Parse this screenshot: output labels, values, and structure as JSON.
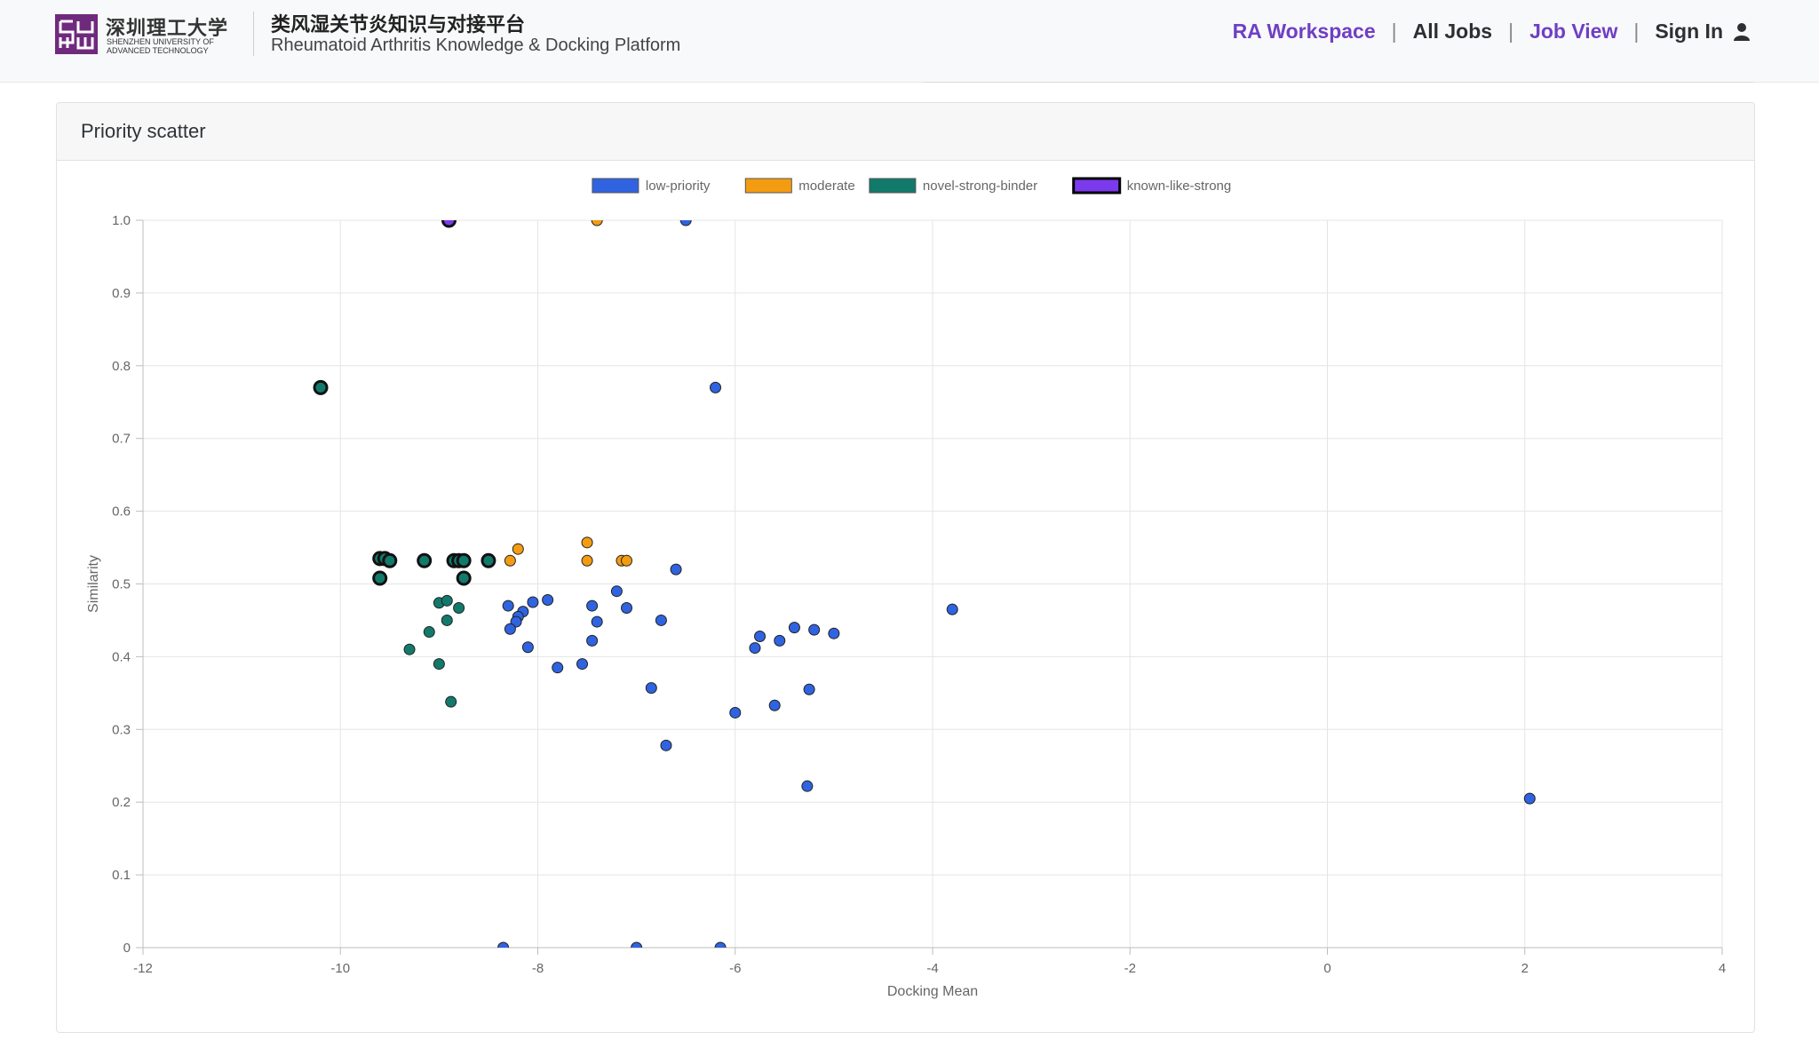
{
  "header": {
    "logo": {
      "cn": "深圳理工大学",
      "en": "SHENZHEN UNIVERSITY OF ADVANCED TECHNOLOGY",
      "mark": "SUAT"
    },
    "title_cn": "类风湿关节炎知识与对接平台",
    "title_en": "Rheumatoid Arthritis Knowledge & Docking Platform"
  },
  "nav": {
    "items": [
      {
        "label": "RA Workspace",
        "color": "#6f3fc4"
      },
      {
        "label": "All Jobs",
        "color": "#2d2f33"
      },
      {
        "label": "Job View",
        "color": "#6f3fc4"
      },
      {
        "label": "Sign In",
        "color": "#2d2f33"
      }
    ],
    "separator": "|",
    "user_icon": "user-icon"
  },
  "panel": {
    "title": "Priority scatter"
  },
  "chart_data": {
    "type": "scatter",
    "xlabel": "Docking Mean",
    "ylabel": "Similarity",
    "xlim": [
      -12,
      4
    ],
    "ylim": [
      0,
      1
    ],
    "x_ticks": [
      -12,
      -10,
      -8,
      -6,
      -4,
      -2,
      0,
      2,
      4
    ],
    "y_ticks": [
      0,
      0.1,
      0.2,
      0.3,
      0.4,
      0.5,
      0.6,
      0.7,
      0.8,
      0.9,
      1.0
    ],
    "y_tick_labels": [
      "0",
      "0.1",
      "0.2",
      "0.3",
      "0.4",
      "0.5",
      "0.6",
      "0.7",
      "0.8",
      "0.9",
      "1.0"
    ],
    "grid": true,
    "legend_position": "top-center",
    "series": [
      {
        "name": "low-priority",
        "color": "#2f63e0",
        "points": [
          [
            -6.2,
            0.77
          ],
          [
            -6.6,
            0.52
          ],
          [
            -3.8,
            0.465
          ],
          [
            2.05,
            0.205
          ],
          [
            -7.2,
            0.49
          ],
          [
            -7.45,
            0.47
          ],
          [
            -7.1,
            0.467
          ],
          [
            -7.9,
            0.478
          ],
          [
            -8.05,
            0.475
          ],
          [
            -8.3,
            0.47
          ],
          [
            -8.15,
            0.462
          ],
          [
            -8.2,
            0.455
          ],
          [
            -8.22,
            0.448
          ],
          [
            -8.28,
            0.438
          ],
          [
            -7.4,
            0.448
          ],
          [
            -7.45,
            0.422
          ],
          [
            -8.1,
            0.413
          ],
          [
            -7.8,
            0.385
          ],
          [
            -7.55,
            0.39
          ],
          [
            -6.75,
            0.45
          ],
          [
            -5.8,
            0.412
          ],
          [
            -5.75,
            0.428
          ],
          [
            -5.55,
            0.422
          ],
          [
            -5.4,
            0.44
          ],
          [
            -5.2,
            0.437
          ],
          [
            -5.0,
            0.432
          ],
          [
            -6.85,
            0.357
          ],
          [
            -5.25,
            0.355
          ],
          [
            -5.6,
            0.333
          ],
          [
            -6.0,
            0.323
          ],
          [
            -6.7,
            0.278
          ],
          [
            -5.27,
            0.222
          ],
          [
            -8.35,
            0.0
          ],
          [
            -7.0,
            0.0
          ],
          [
            -6.15,
            0.0
          ],
          [
            -6.5,
            1.0
          ]
        ]
      },
      {
        "name": "moderate",
        "color": "#f39c12",
        "points": [
          [
            -7.5,
            0.557
          ],
          [
            -8.2,
            0.548
          ],
          [
            -8.28,
            0.532
          ],
          [
            -7.5,
            0.532
          ],
          [
            -7.15,
            0.532
          ],
          [
            -7.1,
            0.532
          ],
          [
            -7.4,
            1.0
          ]
        ]
      },
      {
        "name": "novel-strong-binder",
        "color": "#127a6b",
        "points": [
          [
            -10.2,
            0.77
          ],
          [
            -9.6,
            0.535
          ],
          [
            -9.55,
            0.535
          ],
          [
            -9.5,
            0.532
          ],
          [
            -9.15,
            0.532
          ],
          [
            -8.85,
            0.532
          ],
          [
            -8.8,
            0.532
          ],
          [
            -8.75,
            0.532
          ],
          [
            -8.5,
            0.532
          ],
          [
            -9.6,
            0.508
          ],
          [
            -8.75,
            0.508
          ],
          [
            -9.0,
            0.474
          ],
          [
            -8.92,
            0.477
          ],
          [
            -8.8,
            0.467
          ],
          [
            -8.92,
            0.45
          ],
          [
            -9.1,
            0.434
          ],
          [
            -9.3,
            0.41
          ],
          [
            -9.0,
            0.39
          ],
          [
            -8.88,
            0.338
          ]
        ]
      },
      {
        "name": "known-like-strong",
        "color": "#7c3aed",
        "points": [
          [
            -8.9,
            1.0
          ]
        ]
      }
    ]
  }
}
